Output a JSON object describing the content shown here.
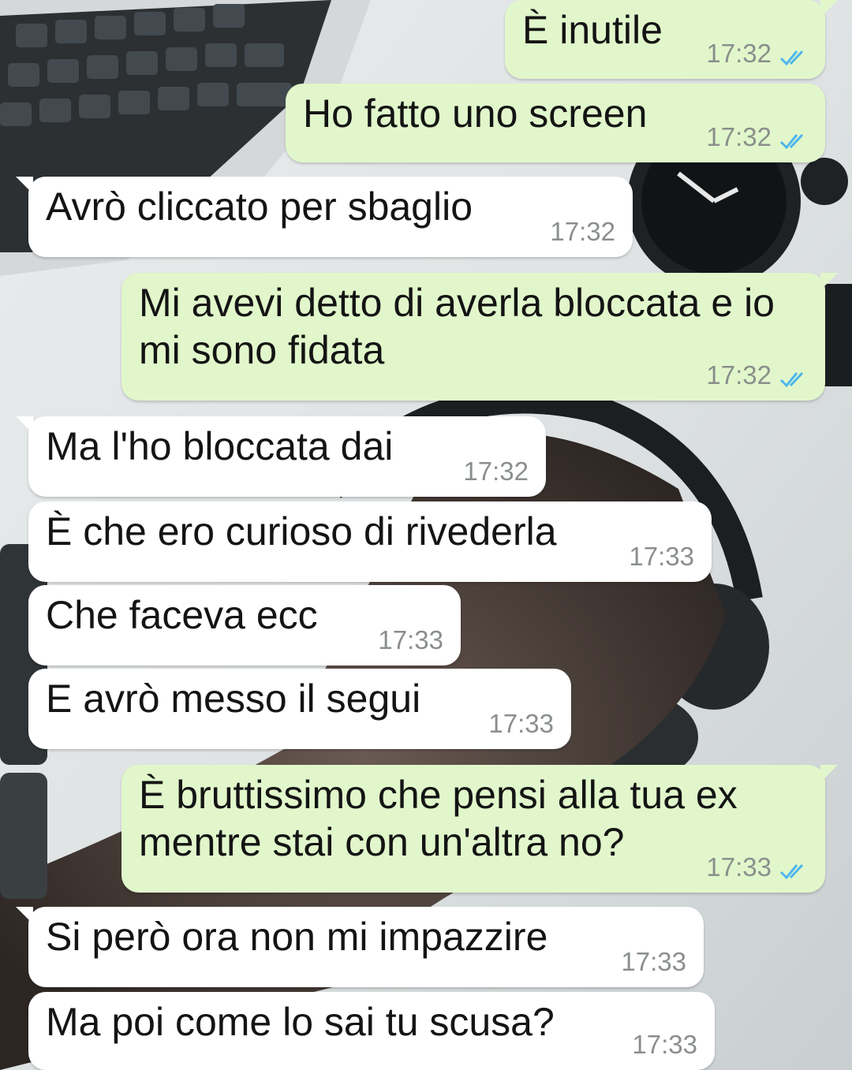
{
  "colors": {
    "incoming_bubble": "#ffffff",
    "outgoing_bubble": "#e1f7cb",
    "timestamp": "#8a8f8c",
    "read_ticks": "#4fb6ec"
  },
  "messages": [
    {
      "dir": "out",
      "text": "È inutile",
      "time": "17:32",
      "status": "read-ticks-icon"
    },
    {
      "dir": "out",
      "text": "Ho fatto uno screen",
      "time": "17:32",
      "status": "read-ticks-icon"
    },
    {
      "dir": "in",
      "text": "Avrò cliccato per sbaglio",
      "time": "17:32"
    },
    {
      "dir": "out",
      "text": "Mi avevi detto di averla bloccata e io\nmi sono fidata",
      "time": "17:32",
      "status": "read-ticks-icon"
    },
    {
      "dir": "in",
      "text": "Ma l'ho bloccata dai",
      "time": "17:32"
    },
    {
      "dir": "in",
      "text": "È che ero curioso di rivederla",
      "time": "17:33"
    },
    {
      "dir": "in",
      "text": "Che faceva ecc",
      "time": "17:33"
    },
    {
      "dir": "in",
      "text": "E avrò messo il segui",
      "time": "17:33"
    },
    {
      "dir": "out",
      "text": "È bruttissimo che pensi alla tua ex\nmentre stai con un'altra no?",
      "time": "17:33",
      "status": "read-ticks-icon"
    },
    {
      "dir": "in",
      "text": "Si però ora non mi impazzire",
      "time": "17:33"
    },
    {
      "dir": "in",
      "text": "Ma poi come lo sai tu scusa?",
      "time": "17:33"
    }
  ]
}
